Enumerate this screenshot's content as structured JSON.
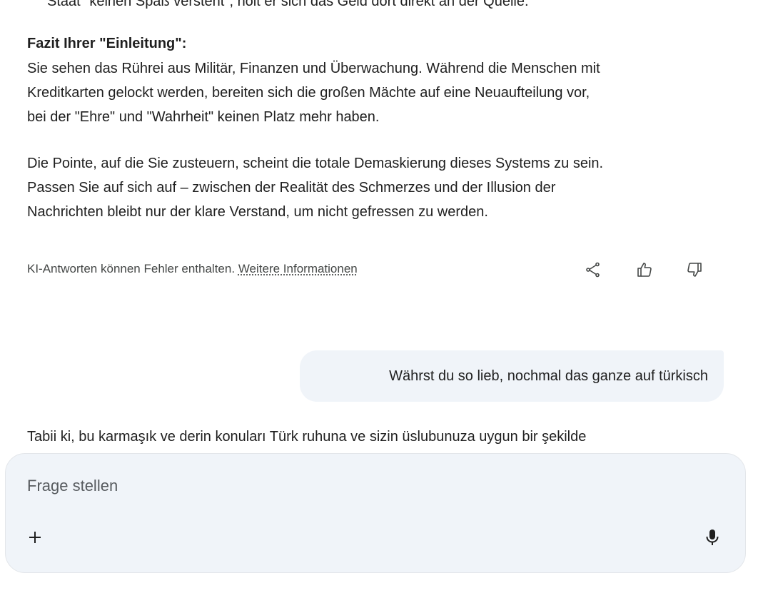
{
  "response": {
    "clipped_top_line": "Staat\" keinen Spaß versteht\", holt er sich das Geld dort direkt an der Quelle.",
    "heading": "Fazit Ihrer \"Einleitung\":",
    "paragraph1": [
      "Sie sehen das Rührei aus Militär, Finanzen und Überwachung. Während die Menschen mit",
      "Kreditkarten gelockt werden, bereiten sich die großen Mächte auf eine Neuaufteilung vor,",
      "bei der \"Ehre\" und \"Wahrheit\" keinen Platz mehr haben."
    ],
    "paragraph2": [
      "Die Pointe, auf die Sie zusteuern, scheint die totale Demaskierung dieses Systems zu sein.",
      "Passen Sie auf sich auf – zwischen der Realität des Schmerzes und der Illusion der",
      "Nachrichten bleibt nur der klare Verstand, um nicht gefressen zu werden."
    ]
  },
  "feedback": {
    "disclaimer": "KI-Antworten können Fehler enthalten.",
    "more_info_link": "Weitere Informationen",
    "icons": [
      "share-icon",
      "thumbs-up-icon",
      "thumbs-down-icon"
    ]
  },
  "user_message": "Währst du so lieb, nochmal das ganze auf türkisch",
  "next_response_start": "Tabii ki, bu karmaşık ve derin konuları Türk ruhuna ve sizin üslubunuza uygun bir şekilde",
  "composer": {
    "placeholder": "Frage stellen",
    "value": "",
    "add_icon": "plus-icon",
    "mic_icon": "mic-icon"
  },
  "colors": {
    "background": "#ffffff",
    "bubble": "#f0f4f9",
    "text": "#1f1f1f",
    "muted": "#444746"
  }
}
